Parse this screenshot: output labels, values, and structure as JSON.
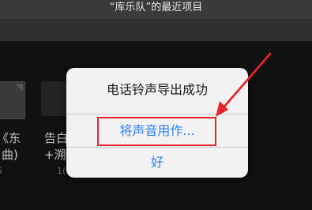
{
  "header": {
    "title": "“库乐队”的最近项目"
  },
  "background_items": [
    {
      "title_line1": "《东",
      "title_line2": "曲)",
      "meta": "5"
    },
    {
      "title_line1": "告白",
      "title_line2": "+溯",
      "meta": "1("
    }
  ],
  "alert": {
    "title": "电话铃声导出成功",
    "use_sound_label": "将声音用作...",
    "ok_label": "好"
  },
  "annotation": {
    "color": "#e5252a"
  },
  "colors": {
    "accent": "#2e7ff5",
    "alert_background": "#f2f2f2"
  }
}
